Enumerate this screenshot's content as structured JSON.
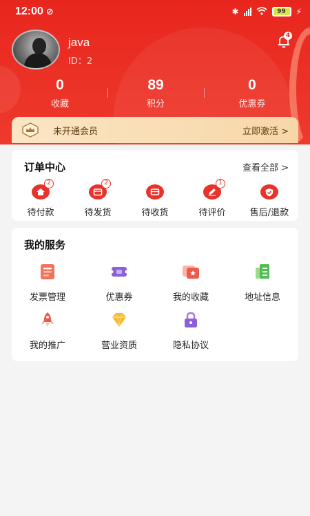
{
  "status_bar": {
    "time": "12:00",
    "battery": "99"
  },
  "profile": {
    "username": "java",
    "user_id": "ID：2",
    "notification_count": "4"
  },
  "stats": [
    {
      "value": "0",
      "label": "收藏"
    },
    {
      "value": "89",
      "label": "积分"
    },
    {
      "value": "0",
      "label": "优惠券"
    }
  ],
  "member": {
    "text": "未开通会员",
    "action": "立即激活 >"
  },
  "orders": {
    "title": "订单中心",
    "more": "查看全部 >",
    "items": [
      {
        "label": "待付款",
        "badge": "2",
        "icon": "wallet-icon"
      },
      {
        "label": "待发货",
        "badge": "2",
        "icon": "package-icon"
      },
      {
        "label": "待收货",
        "badge": "",
        "icon": "truck-icon"
      },
      {
        "label": "待评价",
        "badge": "1",
        "icon": "pen-icon"
      },
      {
        "label": "售后/退款",
        "badge": "",
        "icon": "shield-icon"
      }
    ]
  },
  "services": {
    "title": "我的服务",
    "items": [
      {
        "label": "发票管理",
        "icon": "invoice-icon"
      },
      {
        "label": "优惠券",
        "icon": "coupon-icon"
      },
      {
        "label": "我的收藏",
        "icon": "favorite-icon"
      },
      {
        "label": "地址信息",
        "icon": "address-icon"
      },
      {
        "label": "我的推广",
        "icon": "rocket-icon"
      },
      {
        "label": "营业资质",
        "icon": "diamond-icon"
      },
      {
        "label": "隐私协议",
        "icon": "lock-icon"
      }
    ]
  },
  "colors": {
    "brand_red": "#e8261e",
    "member_gold": "#f7d7a8"
  }
}
